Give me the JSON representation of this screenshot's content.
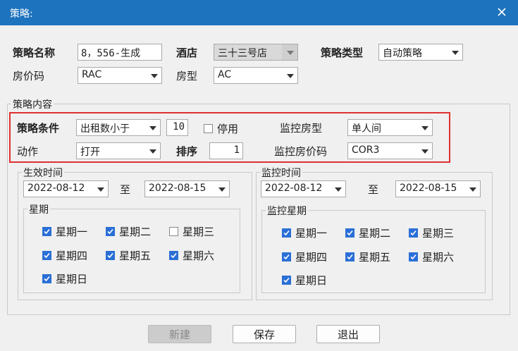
{
  "window": {
    "title": "策略:"
  },
  "strategy": {
    "name_label": "策略名称",
    "name_value": "8，556-生成",
    "hotel_label": "酒店",
    "hotel_value": "三十三号店",
    "type_label": "策略类型",
    "type_value": "自动策略",
    "rate_code_label": "房价码",
    "rate_code_value": "RAC",
    "room_type_label": "房型",
    "room_type_value": "AC"
  },
  "content": {
    "group_label": "策略内容",
    "condition_label": "策略条件",
    "condition_value": "出租数小于",
    "condition_number": "10",
    "disabled_label": "停用",
    "disabled_checked": false,
    "monitor_room_type_label": "监控房型",
    "monitor_room_type_value": "单人间",
    "action_label": "动作",
    "action_value": "打开",
    "order_label": "排序",
    "order_value": "1",
    "monitor_rate_code_label": "监控房价码",
    "monitor_rate_code_value": "COR3"
  },
  "effective": {
    "group_label": "生效时间",
    "start": "2022-08-12",
    "to_label": "至",
    "end": "2022-08-15",
    "week_label": "星期",
    "days": [
      {
        "label": "星期一",
        "checked": true
      },
      {
        "label": "星期二",
        "checked": true
      },
      {
        "label": "星期三",
        "checked": false
      },
      {
        "label": "星期四",
        "checked": true
      },
      {
        "label": "星期五",
        "checked": true
      },
      {
        "label": "星期六",
        "checked": true
      },
      {
        "label": "星期日",
        "checked": true
      }
    ]
  },
  "monitor": {
    "group_label": "监控时间",
    "start": "2022-08-12",
    "to_label": "至",
    "end": "2022-08-15",
    "week_label": "监控星期",
    "days": [
      {
        "label": "星期一",
        "checked": true
      },
      {
        "label": "星期二",
        "checked": true
      },
      {
        "label": "星期三",
        "checked": true
      },
      {
        "label": "星期四",
        "checked": true
      },
      {
        "label": "星期五",
        "checked": true
      },
      {
        "label": "星期六",
        "checked": true
      },
      {
        "label": "星期日",
        "checked": true
      }
    ]
  },
  "buttons": {
    "new_label": "新建",
    "save_label": "保存",
    "exit_label": "退出"
  },
  "colors": {
    "titlebar": "#1e73be",
    "highlight": "#e03030",
    "check": "#2a6fd6"
  }
}
